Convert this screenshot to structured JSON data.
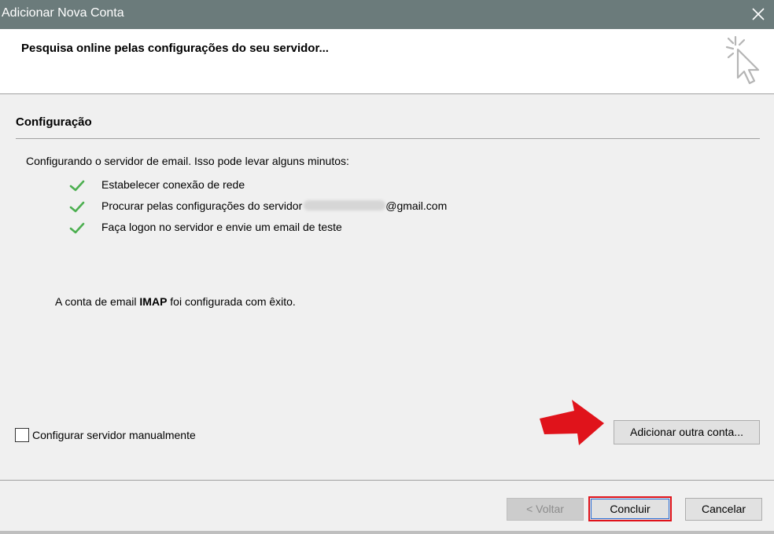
{
  "window": {
    "title": "Adicionar Nova Conta",
    "close_icon": "close-icon"
  },
  "header": {
    "heading": "Pesquisa online pelas configurações do seu servidor...",
    "icon": "clicking-cursor-icon"
  },
  "section": {
    "title": "Configuração",
    "intro": "Configurando o servidor de email. Isso pode levar alguns minutos:"
  },
  "steps": [
    {
      "label": "Estabelecer conexão de rede",
      "status": "done"
    },
    {
      "label_prefix": "Procurar pelas configurações do servidor",
      "label_suffix": "@gmail.com",
      "status": "done"
    },
    {
      "label": "Faça logon no servidor e envie um email de teste",
      "status": "done"
    }
  ],
  "result": {
    "prefix": "A conta de email ",
    "protocol": "IMAP",
    "suffix": " foi configurada com êxito."
  },
  "manual_config": {
    "label": "Configurar servidor manualmente",
    "checked": false
  },
  "buttons": {
    "add_account": "Adicionar outra conta...",
    "back": "< Voltar",
    "finish": "Concluir",
    "cancel": "Cancelar"
  },
  "colors": {
    "titlebar": "#6b7b7b",
    "check": "#4caf50",
    "highlight_red": "#e0131b"
  }
}
